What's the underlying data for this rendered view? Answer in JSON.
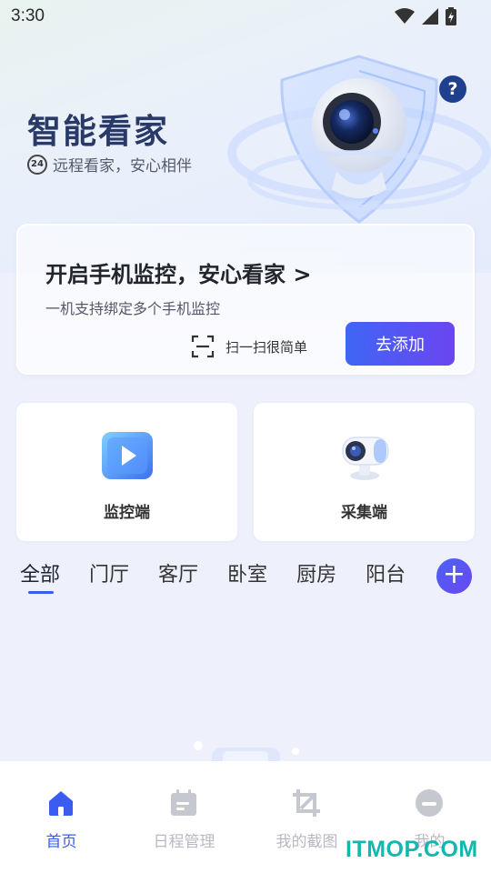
{
  "status_bar": {
    "time": "3:30"
  },
  "hero": {
    "title": "智能看家",
    "badge": "24",
    "subtitle": "远程看家，安心相伴",
    "help": "?"
  },
  "promo_card": {
    "title": "开启手机监控，安心看家 >",
    "description": "一机支持绑定多个手机监控",
    "scan_label": "扫一扫很简单",
    "add_button": "去添加"
  },
  "tiles": [
    {
      "label": "监控端",
      "icon": "monitor-play-icon"
    },
    {
      "label": "采集端",
      "icon": "camera-icon"
    }
  ],
  "room_tabs": {
    "items": [
      "全部",
      "门厅",
      "客厅",
      "卧室",
      "厨房",
      "阳台"
    ],
    "active_index": 0,
    "add": "+"
  },
  "bottom_nav": {
    "items": [
      {
        "label": "首页",
        "icon": "home-icon",
        "active": true
      },
      {
        "label": "日程管理",
        "icon": "calendar-icon",
        "active": false
      },
      {
        "label": "我的截图",
        "icon": "crop-icon",
        "active": false
      },
      {
        "label": "我的",
        "icon": "profile-icon",
        "active": false
      }
    ]
  },
  "watermark": "ITMOP.COM",
  "colors": {
    "accent": "#3a5cf0",
    "accent2": "#6b45f0",
    "title": "#2a3a68",
    "watermark": "#12b8b0"
  }
}
